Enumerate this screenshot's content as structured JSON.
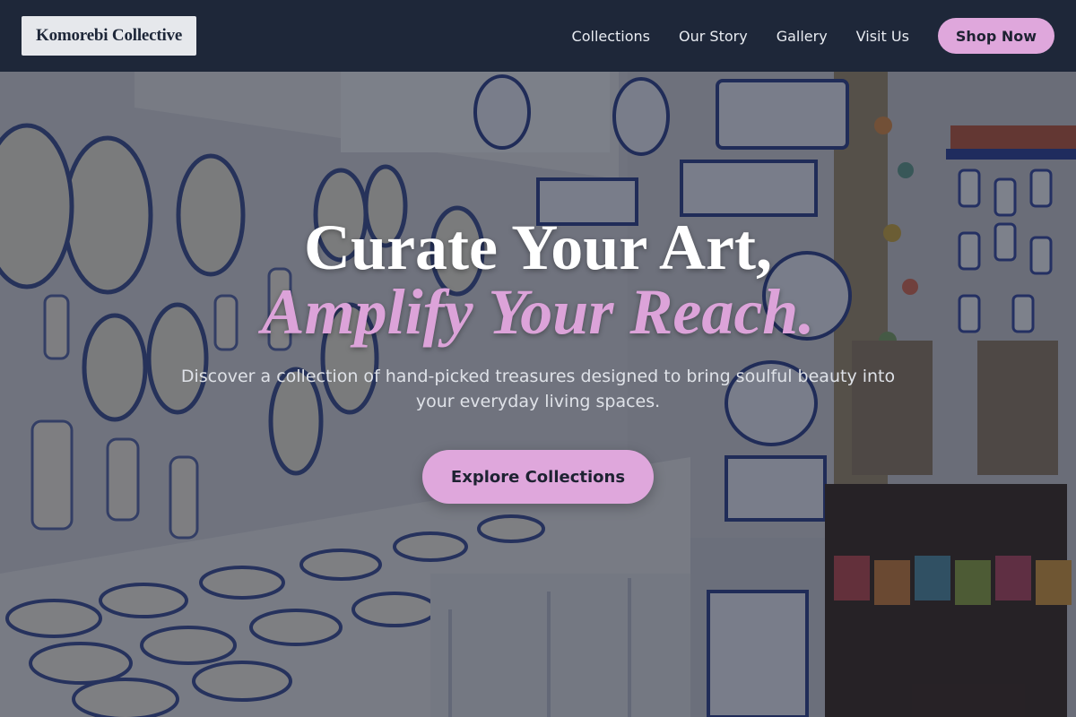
{
  "brand": {
    "logo_text": "Komorebi Collective"
  },
  "nav": {
    "links": [
      "Collections",
      "Our Story",
      "Gallery",
      "Visit Us"
    ],
    "cta_label": "Shop Now"
  },
  "hero": {
    "headline_line1": "Curate Your Art,",
    "headline_line2": "Amplify Your Reach.",
    "subtitle": "Discover a collection of hand-picked treasures designed to bring soulful beauty into your everyday living spaces.",
    "cta_label": "Explore Collections"
  },
  "colors": {
    "nav_background": "#1e2739",
    "accent_pink": "#dfa7dc",
    "headline_italic": "#dca3d9",
    "logo_background": "#e6e8ec",
    "text_light": "#e9ecf2"
  },
  "background_image": {
    "subject": "ceramics-shop-interior"
  }
}
